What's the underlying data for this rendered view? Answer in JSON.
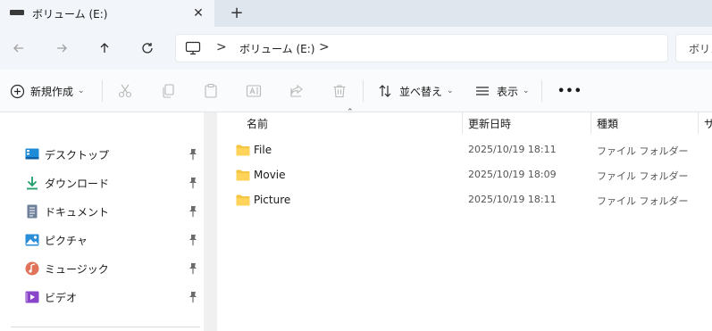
{
  "tab": {
    "title": "ボリューム (E:)",
    "close_glyph": "✕",
    "new_tab_glyph": "+"
  },
  "address": {
    "crumbs": [
      "ボリューム (E:)"
    ],
    "separator": ">",
    "search_placeholder": "ボリュ"
  },
  "commands": {
    "new": "新規作成",
    "sort": "並べ替え",
    "view": "表示",
    "more": "•••"
  },
  "sidebar": {
    "items": [
      {
        "label": "デスクトップ",
        "icon": "desktop-icon"
      },
      {
        "label": "ダウンロード",
        "icon": "download-icon"
      },
      {
        "label": "ドキュメント",
        "icon": "document-icon"
      },
      {
        "label": "ピクチャ",
        "icon": "pictures-icon"
      },
      {
        "label": "ミュージック",
        "icon": "music-icon"
      },
      {
        "label": "ビデオ",
        "icon": "video-icon"
      }
    ]
  },
  "columns": {
    "name": "名前",
    "date": "更新日時",
    "type": "種類",
    "size": "サ"
  },
  "files": [
    {
      "name": "File",
      "date": "2025/10/19 18:11",
      "type": "ファイル フォルダー"
    },
    {
      "name": "Movie",
      "date": "2025/10/19 18:09",
      "type": "ファイル フォルダー"
    },
    {
      "name": "Picture",
      "date": "2025/10/19 18:11",
      "type": "ファイル フォルダー"
    }
  ],
  "colors": {
    "accent": "#0067c0",
    "folder": "#f4c542",
    "toolbar_bg": "#f2f5f9"
  }
}
